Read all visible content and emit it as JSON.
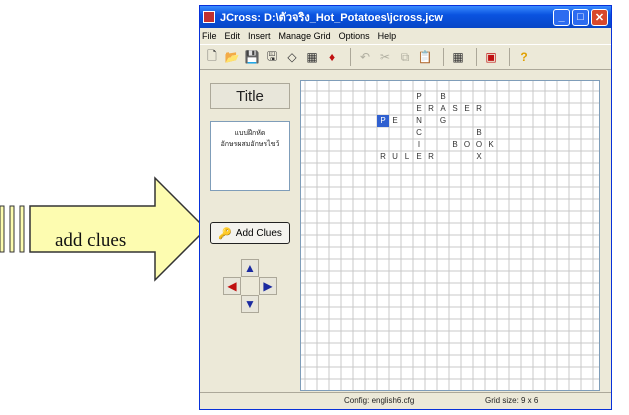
{
  "annotation": {
    "label": "add clues"
  },
  "window": {
    "title": "JCross: D:\\ตัวจริง_Hot_Potatoes\\jcross.jcw",
    "controls": {
      "minimize": "_",
      "maximize": "□",
      "close": "✕"
    }
  },
  "menu": [
    "File",
    "Edit",
    "Insert",
    "Manage Grid",
    "Options",
    "Help"
  ],
  "left_panel": {
    "title_button": "Title",
    "title_text_line1": "แบบฝึกหัด",
    "title_text_line2": "อักษรผสมอักษรไขว้",
    "add_clues_button": "Add Clues"
  },
  "grid": {
    "selected_cell": {
      "row": 2,
      "col": 0
    },
    "letters": [
      {
        "row": 0,
        "col": 3,
        "ch": "P"
      },
      {
        "row": 0,
        "col": 5,
        "ch": "B"
      },
      {
        "row": 1,
        "col": 3,
        "ch": "E"
      },
      {
        "row": 1,
        "col": 4,
        "ch": "R"
      },
      {
        "row": 1,
        "col": 5,
        "ch": "A"
      },
      {
        "row": 1,
        "col": 6,
        "ch": "S"
      },
      {
        "row": 1,
        "col": 7,
        "ch": "E"
      },
      {
        "row": 1,
        "col": 8,
        "ch": "R"
      },
      {
        "row": 2,
        "col": 0,
        "ch": "P"
      },
      {
        "row": 2,
        "col": 1,
        "ch": "E"
      },
      {
        "row": 2,
        "col": 3,
        "ch": "N"
      },
      {
        "row": 2,
        "col": 5,
        "ch": "G"
      },
      {
        "row": 3,
        "col": 3,
        "ch": "C"
      },
      {
        "row": 3,
        "col": 8,
        "ch": "B"
      },
      {
        "row": 4,
        "col": 3,
        "ch": "I"
      },
      {
        "row": 4,
        "col": 6,
        "ch": "B"
      },
      {
        "row": 4,
        "col": 7,
        "ch": "O"
      },
      {
        "row": 4,
        "col": 8,
        "ch": "O"
      },
      {
        "row": 4,
        "col": 9,
        "ch": "K"
      },
      {
        "row": 5,
        "col": 0,
        "ch": "R"
      },
      {
        "row": 5,
        "col": 1,
        "ch": "U"
      },
      {
        "row": 5,
        "col": 2,
        "ch": "L"
      },
      {
        "row": 5,
        "col": 3,
        "ch": "E"
      },
      {
        "row": 5,
        "col": 4,
        "ch": "R"
      },
      {
        "row": 5,
        "col": 8,
        "ch": "X"
      }
    ]
  },
  "status": {
    "config": "Config: english6.cfg",
    "grid_size": "Grid size: 9 x 6"
  },
  "colors": {
    "titlebar": "#0a53e0",
    "selected_cell": "#3060d0",
    "arrow_fill": "#fdfcb0"
  }
}
